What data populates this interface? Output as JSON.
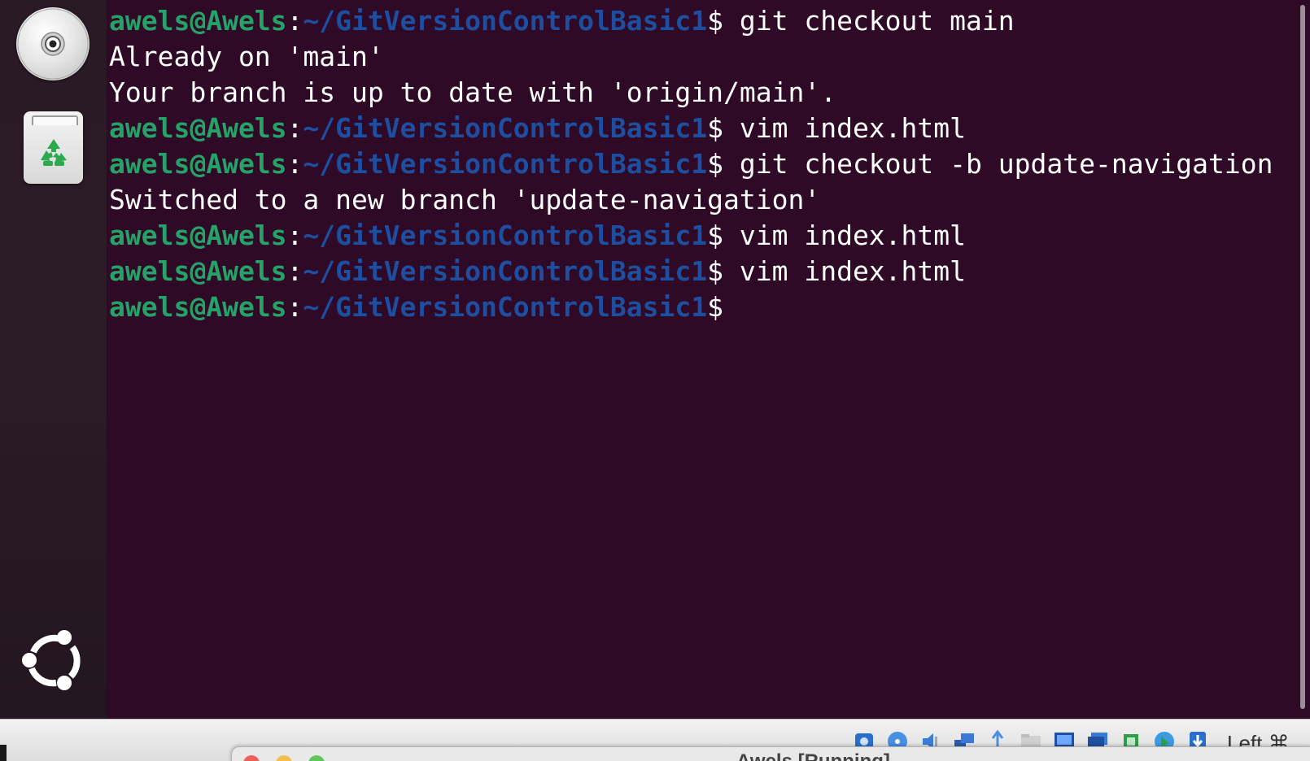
{
  "dock": {
    "items": [
      {
        "name": "optical-disc",
        "icon": "disc-icon"
      },
      {
        "name": "trash",
        "icon": "recycle-icon"
      }
    ],
    "apps_icon": "ubuntu-logo-icon"
  },
  "terminal": {
    "colors": {
      "background": "#2f0a26",
      "user": "#26a269",
      "path": "#1d4ea0",
      "text": "#ffffff"
    },
    "lines": [
      {
        "type": "prompt",
        "user": "awels@Awels",
        "sep": ":",
        "path": "~/GitVersionControlBasic1",
        "symbol": "$",
        "cmd": " git checkout main"
      },
      {
        "type": "output",
        "text": "Already on 'main'"
      },
      {
        "type": "output",
        "text": "Your branch is up to date with 'origin/main'."
      },
      {
        "type": "prompt",
        "user": "awels@Awels",
        "sep": ":",
        "path": "~/GitVersionControlBasic1",
        "symbol": "$",
        "cmd": " vim index.html"
      },
      {
        "type": "prompt",
        "user": "awels@Awels",
        "sep": ":",
        "path": "~/GitVersionControlBasic1",
        "symbol": "$",
        "cmd": " git checkout -b update-navigation"
      },
      {
        "type": "output",
        "text": "Switched to a new branch 'update-navigation'"
      },
      {
        "type": "prompt",
        "user": "awels@Awels",
        "sep": ":",
        "path": "~/GitVersionControlBasic1",
        "symbol": "$",
        "cmd": " vim index.html"
      },
      {
        "type": "prompt",
        "user": "awels@Awels",
        "sep": ":",
        "path": "~/GitVersionControlBasic1",
        "symbol": "$",
        "cmd": " vim index.html"
      },
      {
        "type": "prompt",
        "user": "awels@Awels",
        "sep": ":",
        "path": "~/GitVersionControlBasic1",
        "symbol": "$",
        "cmd": ""
      }
    ]
  },
  "statusbar": {
    "icons": [
      "hard-disk-icon",
      "optical-drive-icon",
      "audio-icon",
      "network-icon",
      "usb-icon",
      "shared-folder-icon",
      "display-icon",
      "screen-capture-icon",
      "cpu-icon",
      "mouse-integration-icon",
      "keyboard-capture-icon"
    ],
    "host_key": "Left ⌘"
  },
  "host_window": {
    "title": "Awels [Running]"
  }
}
